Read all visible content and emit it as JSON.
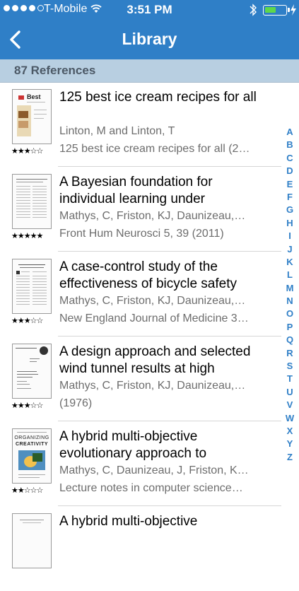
{
  "status": {
    "carrier": "T-Mobile",
    "time": "3:51 PM",
    "battery_level": 0.55
  },
  "nav": {
    "title": "Library",
    "back_icon": "chevron-left-icon"
  },
  "section": {
    "header": "87 References"
  },
  "references": [
    {
      "title": "125 best ice cream recipes for all",
      "authors": "Linton, M and Linton, T",
      "source": "125 best ice cream recipes for all (2…",
      "stars": "★★★☆☆",
      "rating": 3
    },
    {
      "title": "A Bayesian foundation for individual learning under",
      "authors": "Mathys, C, Friston, KJ, Daunizeau,…",
      "source": "Front Hum Neurosci 5, 39 (2011)",
      "stars": "★★★★★",
      "rating": 5
    },
    {
      "title": "A case-control study of the effectiveness of bicycle safety",
      "authors": "Mathys, C, Friston, KJ, Daunizeau,…",
      "source": "New England Journal of Medicine 3…",
      "stars": "★★★☆☆",
      "rating": 3
    },
    {
      "title": "A design approach and selected wind tunnel results at high",
      "authors": "Mathys, C, Friston, KJ, Daunizeau,…",
      "source": " (1976)",
      "stars": "★★★☆☆",
      "rating": 3
    },
    {
      "title": "A hybrid multi-objective evolutionary approach to",
      "authors": "Mathys, C, Daunizeau, J, Friston, K…",
      "source": "Lecture notes in computer science…",
      "stars": "★★☆☆☆",
      "rating": 2
    },
    {
      "title": "A hybrid multi-objective",
      "authors": "",
      "source": "",
      "stars": "",
      "rating": null
    }
  ],
  "thumb_text": {
    "cover1": "Best",
    "cover5_line1": "ORGANIZING",
    "cover5_line2": "CREATIVITY"
  },
  "index_letters": [
    "A",
    "B",
    "C",
    "D",
    "E",
    "F",
    "G",
    "H",
    "I",
    "J",
    "K",
    "L",
    "M",
    "N",
    "O",
    "P",
    "Q",
    "R",
    "S",
    "T",
    "U",
    "V",
    "W",
    "X",
    "Y",
    "Z"
  ],
  "colors": {
    "nav_blue": "#2f7fc7",
    "section_bg": "#b8cfe1",
    "index_blue": "#2f7fc7",
    "battery_green": "#5fd84a"
  }
}
